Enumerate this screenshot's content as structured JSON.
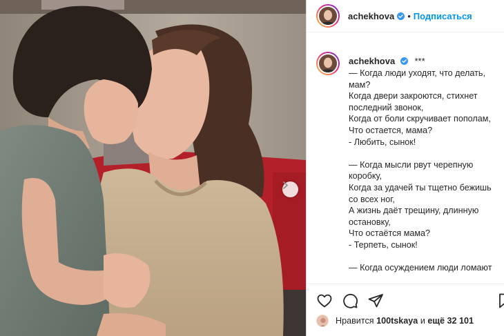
{
  "post": {
    "author": "achekhova",
    "follow_label": "Подписаться",
    "separator": "•",
    "caption_prefix": "***",
    "caption_text": "— Когда люди уходят, что делать,\nмам?\nКогда двери закроются, стихнет\nпоследний звонок,\nКогда от боли скручивает пополам,\nЧто остается, мама?\n- Любить, сынок!\n\n— Когда мысли рвут черепную\nкоробку,\nКогда за удачей ты тщетно бежишь\nсо всех ног,\nА жизнь даёт трещину, длинную\nостановку,\nЧто остаётся мама?\n- Терпеть, сынок!\n\n— Когда осуждением люди ломают",
    "likes": {
      "prefix": "Нравится",
      "user": "100tskaya",
      "middle": "и",
      "rest": "ещё 32 101"
    }
  },
  "icons": {
    "verified": "verified-badge-icon",
    "next": "chevron-right-icon",
    "like": "heart-icon",
    "comment": "comment-icon",
    "share": "send-icon",
    "save": "bookmark-icon"
  },
  "colors": {
    "accent": "#0095f6",
    "text": "#262626",
    "border": "#dbdbdb"
  }
}
